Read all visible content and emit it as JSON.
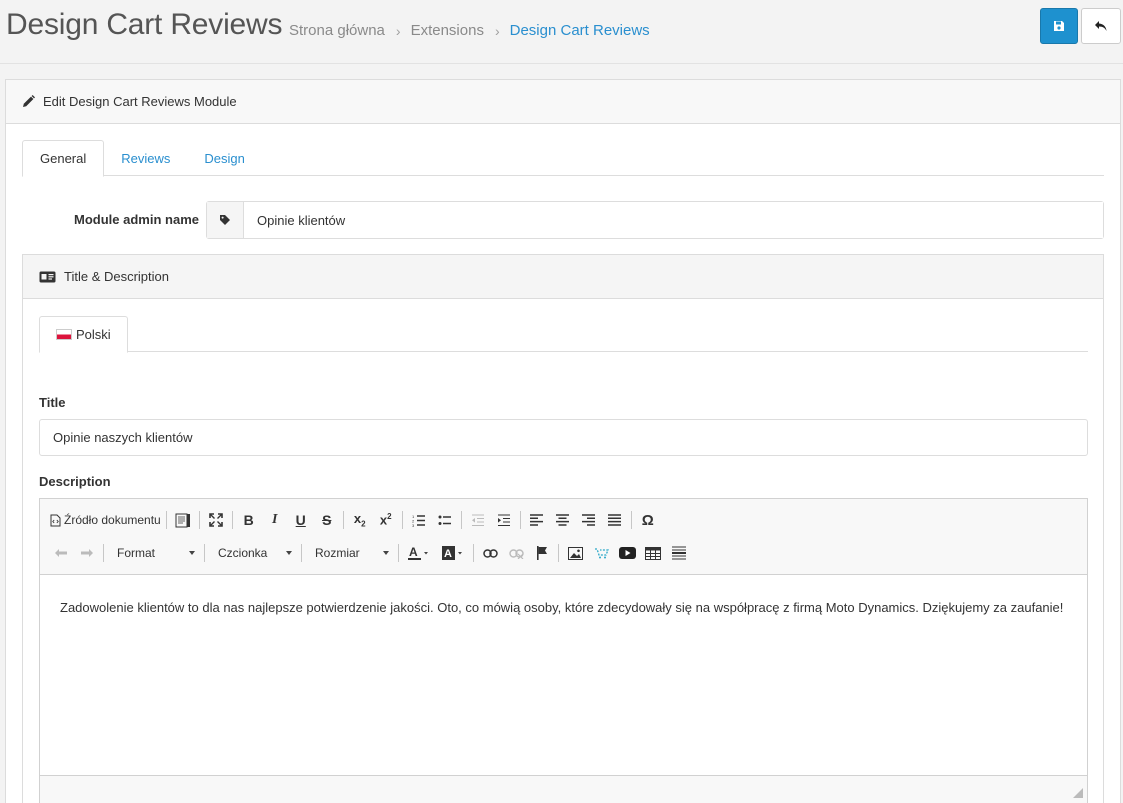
{
  "header": {
    "title": "Design Cart Reviews",
    "breadcrumb": [
      "Strona główna",
      "Extensions",
      "Design Cart Reviews"
    ],
    "save_icon": "save-icon",
    "back_icon": "reply-icon",
    "save_color": "#1e91cf"
  },
  "panel": {
    "heading": "Edit Design Cart Reviews Module",
    "heading_icon": "pencil-icon",
    "tabs": [
      {
        "label": "General",
        "active": true
      },
      {
        "label": "Reviews",
        "active": false
      },
      {
        "label": "Design",
        "active": false
      }
    ]
  },
  "form": {
    "module_name_label": "Module admin name",
    "module_name_value": "Opinie klientów",
    "module_name_icon": "tag-icon"
  },
  "section": {
    "heading": "Title & Description",
    "heading_icon": "id-card-icon",
    "language_tab": "Polski",
    "language_flag": "poland-flag",
    "title_label": "Title",
    "title_value": "Opinie naszych klientów",
    "description_label": "Description"
  },
  "editor": {
    "source_label": "Źródło dokumentu",
    "format_label": "Format",
    "font_label": "Czcionka",
    "size_label": "Rozmiar",
    "content": "Zadowolenie klientów to dla nas najlepsze potwierdzenie jakości. Oto, co mówią osoby, które zdecydowały się na współpracę z firmą Moto Dynamics. Dziękujemy za zaufanie!"
  }
}
